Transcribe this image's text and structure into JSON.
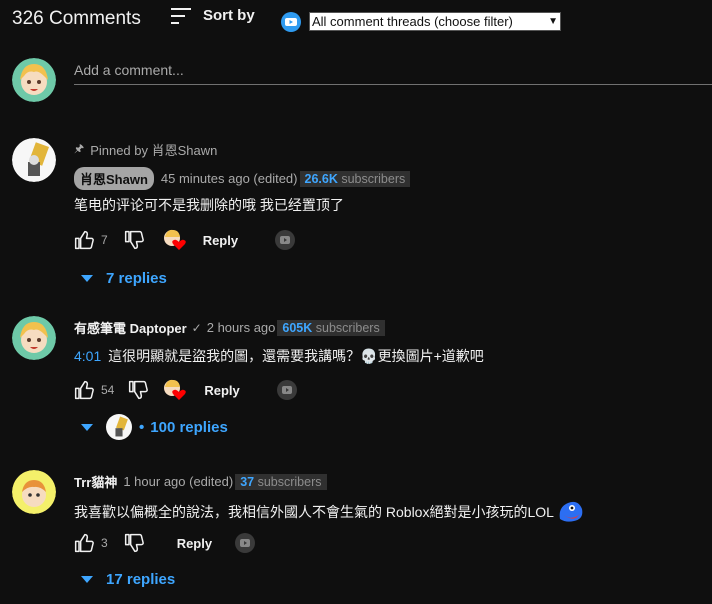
{
  "header": {
    "comment_count": "326 Comments",
    "sort_label": "Sort by",
    "filter_selected": "All comment threads (choose filter)"
  },
  "composer": {
    "placeholder": "Add a comment..."
  },
  "comments": [
    {
      "pinned_text": "Pinned by 肖恩Shawn",
      "author": "肖恩Shawn",
      "time": "45 minutes ago (edited)",
      "subs_count": "26.6K",
      "subs_suffix": "subscribers",
      "text": "笔电的评论可不是我删除的哦 我已经置顶了",
      "likes": "7",
      "reply_label": "Reply",
      "replies": "7 replies"
    },
    {
      "author": "有感筆電 Daptoper",
      "verified_mark": "✓",
      "time": "2 hours ago",
      "subs_count": "605K",
      "subs_suffix": "subscribers",
      "timestamp_link": "4:01",
      "text": "這很明顯就是盜我的圖，還需要我講嗎？💀更換圖片+道歉吧",
      "likes": "54",
      "reply_label": "Reply",
      "replies_bullet": "•",
      "replies": "100 replies"
    },
    {
      "author": "Trr貓神",
      "time": "1 hour ago (edited)",
      "subs_count": "37",
      "subs_suffix": "subscribers",
      "text": "我喜歡以偏概全的說法，我相信外國人不會生氣的 Roblox絕對是小孩玩的LOL",
      "likes": "3",
      "reply_label": "Reply",
      "replies": "17 replies"
    }
  ],
  "colors": {
    "background": "#0f0f0f",
    "link": "#3ea6ff",
    "muted": "#aaaaaa",
    "heart": "#ff0000"
  },
  "icons": [
    "sort-icon",
    "extension-icon",
    "thumb-up-icon",
    "thumb-down-icon",
    "creator-heart-icon",
    "dislike-counter-icon",
    "expand-triangle-icon",
    "pin-icon",
    "verified-icon",
    "blob-emoji-icon"
  ]
}
